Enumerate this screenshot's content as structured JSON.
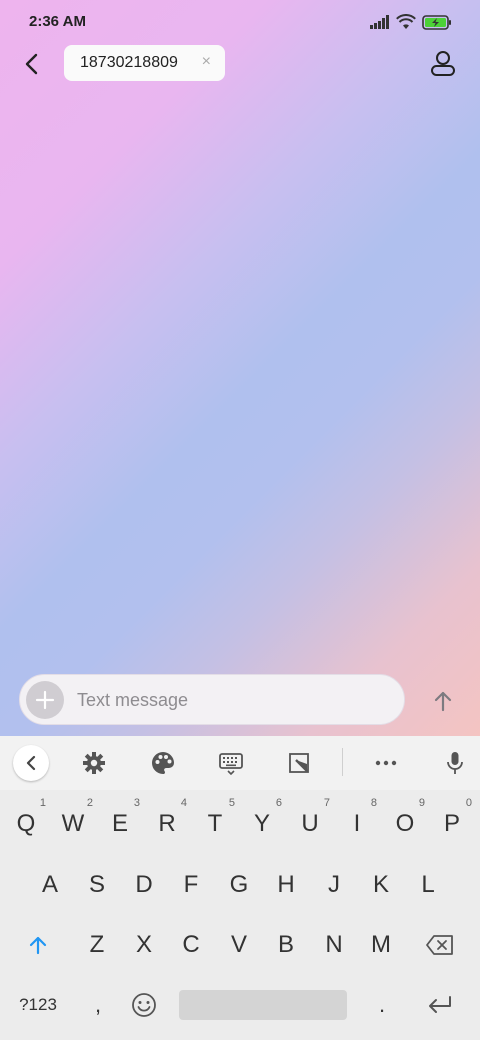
{
  "status_bar": {
    "time": "2:36 AM",
    "icons": [
      "signal-icon",
      "wifi-icon",
      "battery-charging-icon"
    ],
    "battery_color": "#4cd137"
  },
  "top_bar": {
    "recipient": "18730218809",
    "chip_close_glyph": "×",
    "back_icon": "back-arrow-icon",
    "contact_icon": "contact-icon"
  },
  "compose": {
    "placeholder": "Text message",
    "add_glyph": "+",
    "send_icon": "send-arrow-icon"
  },
  "keyboard": {
    "toolbar": [
      "collapse-icon",
      "settings-gear-icon",
      "theme-palette-icon",
      "keyboard-icon",
      "resize-icon",
      "more-dots-icon",
      "microphone-icon"
    ],
    "row1": [
      {
        "key": "Q",
        "hint": "1"
      },
      {
        "key": "W",
        "hint": "2"
      },
      {
        "key": "E",
        "hint": "3"
      },
      {
        "key": "R",
        "hint": "4"
      },
      {
        "key": "T",
        "hint": "5"
      },
      {
        "key": "Y",
        "hint": "6"
      },
      {
        "key": "U",
        "hint": "7"
      },
      {
        "key": "I",
        "hint": "8"
      },
      {
        "key": "O",
        "hint": "9"
      },
      {
        "key": "P",
        "hint": "0"
      }
    ],
    "row2": [
      "A",
      "S",
      "D",
      "F",
      "G",
      "H",
      "J",
      "K",
      "L"
    ],
    "row3": [
      "Z",
      "X",
      "C",
      "V",
      "B",
      "N",
      "M"
    ],
    "symbols_label": "?123",
    "comma": ",",
    "period": ".",
    "accent_color": "#2196f3"
  }
}
